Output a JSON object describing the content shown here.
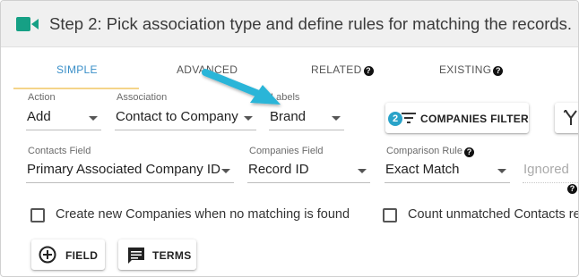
{
  "header": {
    "title": "Step 2: Pick association type and define rules for matching the records.",
    "icon": "video-camera-icon",
    "accent": "#16a085"
  },
  "tabs": [
    {
      "label": "SIMPLE",
      "active": true
    },
    {
      "label": "ADVANCED",
      "active": false
    },
    {
      "label": "RELATED",
      "active": false,
      "help": "?"
    },
    {
      "label": "EXISTING",
      "active": false,
      "help": "?"
    }
  ],
  "row1": {
    "action": {
      "label": "Action",
      "value": "Add"
    },
    "association": {
      "label": "Association",
      "value": "Contact to Company"
    },
    "labels": {
      "label": "Labels",
      "value": "Brand"
    },
    "companies_filter": {
      "count": "2",
      "label": "COMPANIES FILTER"
    }
  },
  "row2": {
    "contacts_field": {
      "label": "Contacts Field",
      "value": "Primary Associated Company ID"
    },
    "companies_field": {
      "label": "Companies Field",
      "value": "Record ID"
    },
    "comparison_rule": {
      "label": "Comparison Rule",
      "value": "Exact Match",
      "help": "?"
    },
    "ignored": {
      "placeholder": "Ignored",
      "help": "?"
    }
  },
  "checkboxes": {
    "create_new": "Create new Companies when no matching is found",
    "count_unmatched": "Count unmatched Contacts re"
  },
  "buttons": {
    "field": "FIELD",
    "terms": "TERMS"
  },
  "colors": {
    "active_tab": "#3a8fc8",
    "badge": "#29a3c9",
    "annotation_arrow": "#2bb5d8"
  }
}
